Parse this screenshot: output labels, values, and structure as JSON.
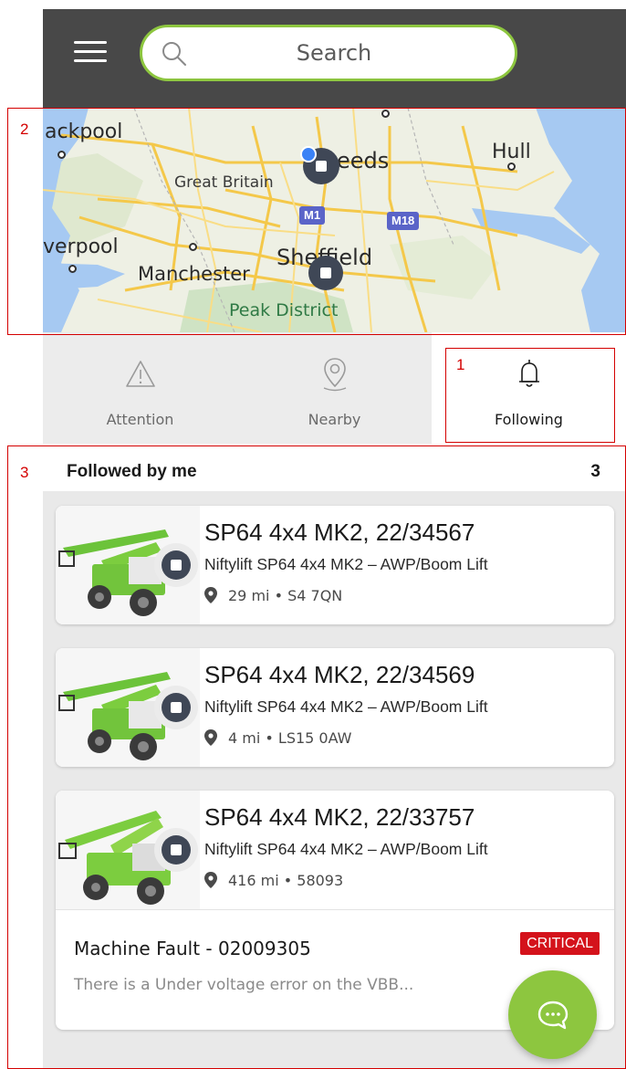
{
  "search": {
    "placeholder": "Search"
  },
  "map": {
    "labels": {
      "blackpool": "ackpool",
      "great_britain": "Great Britain",
      "leeds": "eeds",
      "hull": "Hull",
      "liverpool": "verpool",
      "manchester": "Manchester",
      "sheffield": "Sheffield",
      "peak_district": "Peak District"
    },
    "roads": {
      "m1": "M1",
      "m18": "M18"
    }
  },
  "tabs": [
    {
      "label": "Attention",
      "icon": "warning-icon"
    },
    {
      "label": "Nearby",
      "icon": "location-pin-icon"
    },
    {
      "label": "Following",
      "icon": "bell-icon",
      "active": true
    }
  ],
  "list": {
    "title": "Followed by me",
    "count": "3",
    "items": [
      {
        "title": "SP64 4x4 MK2, 22/34567",
        "subtitle": "Niftylift SP64 4x4 MK2 – AWP/Boom Lift",
        "location": "29 mi • S4 7QN"
      },
      {
        "title": "SP64 4x4 MK2, 22/34569",
        "subtitle": "Niftylift SP64 4x4 MK2 – AWP/Boom Lift",
        "location": "4 mi • LS15 0AW"
      },
      {
        "title": "SP64 4x4 MK2, 22/33757",
        "subtitle": "Niftylift SP64 4x4 MK2 – AWP/Boom Lift",
        "location": "416 mi • 58093",
        "fault": {
          "title": "Machine Fault - 02009305",
          "badge": "CRITICAL",
          "description": "There is a Under voltage error on the VBB..."
        }
      }
    ]
  },
  "annotations": [
    "1",
    "2",
    "3"
  ],
  "colors": {
    "accent": "#8dc63f",
    "critical": "#d4121b",
    "header": "#484848",
    "marker": "#3f4756"
  }
}
